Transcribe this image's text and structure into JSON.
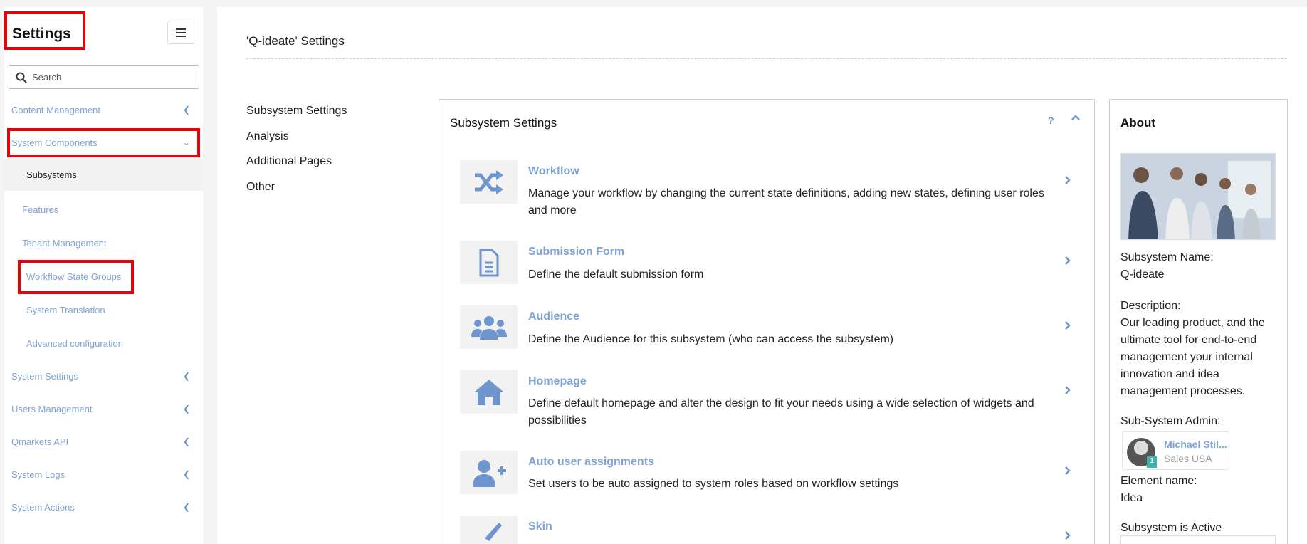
{
  "sidebar": {
    "title": "Settings",
    "search_placeholder": "Search",
    "content_management": "Content Management",
    "system_components": "System Components",
    "sub_items": {
      "subsystems": "Subsystems",
      "features": "Features",
      "tenant_management": "Tenant Management",
      "workflow_state_groups": "Workflow State Groups",
      "system_translation": "System Translation",
      "advanced_configuration": "Advanced configuration"
    },
    "system_settings": "System Settings",
    "users_management": "Users Management",
    "qmarkets_api": "Qmarkets API",
    "system_logs": "System Logs",
    "system_actions": "System Actions"
  },
  "main": {
    "title": "'Q-ideate' Settings",
    "sub_nav": [
      "Subsystem Settings",
      "Analysis",
      "Additional Pages",
      "Other"
    ]
  },
  "card": {
    "title": "Subsystem Settings",
    "help": "?",
    "items": [
      {
        "title": "Workflow",
        "desc": "Manage your workflow by changing the current state definitions, adding new states, defining user roles and more",
        "icon": "shuffle-icon"
      },
      {
        "title": "Submission Form",
        "desc": "Define the default submission form",
        "icon": "document-icon"
      },
      {
        "title": "Audience",
        "desc": "Define the Audience for this subsystem (who can access the subsystem)",
        "icon": "users-icon"
      },
      {
        "title": "Homepage",
        "desc": "Define default homepage and alter the design to fit your needs using a wide selection of widgets and possibilities",
        "icon": "home-icon"
      },
      {
        "title": "Auto user assignments",
        "desc": "Set users to be auto assigned to system roles based on workflow settings",
        "icon": "user-plus-icon"
      },
      {
        "title": "Skin",
        "desc": "",
        "icon": "brush-icon"
      }
    ]
  },
  "about": {
    "title": "About",
    "name_label": "Subsystem Name:",
    "name_value": "Q-ideate",
    "desc_label": "Description:",
    "desc_value": "Our leading product, and the ultimate tool for end-to-end management your internal innovation and idea management processes.",
    "admin_label": "Sub-System Admin:",
    "admin_name": "Michael Stil...",
    "admin_role": "Sales USA",
    "admin_badge": "1",
    "element_label": "Element name:",
    "element_value": "Idea",
    "active_label": "Subsystem is Active"
  },
  "colors": {
    "link": "#7fa3d4",
    "accent": "#6f95cf",
    "highlight": "#e8000b",
    "icon_bg": "#f2f2f2"
  }
}
